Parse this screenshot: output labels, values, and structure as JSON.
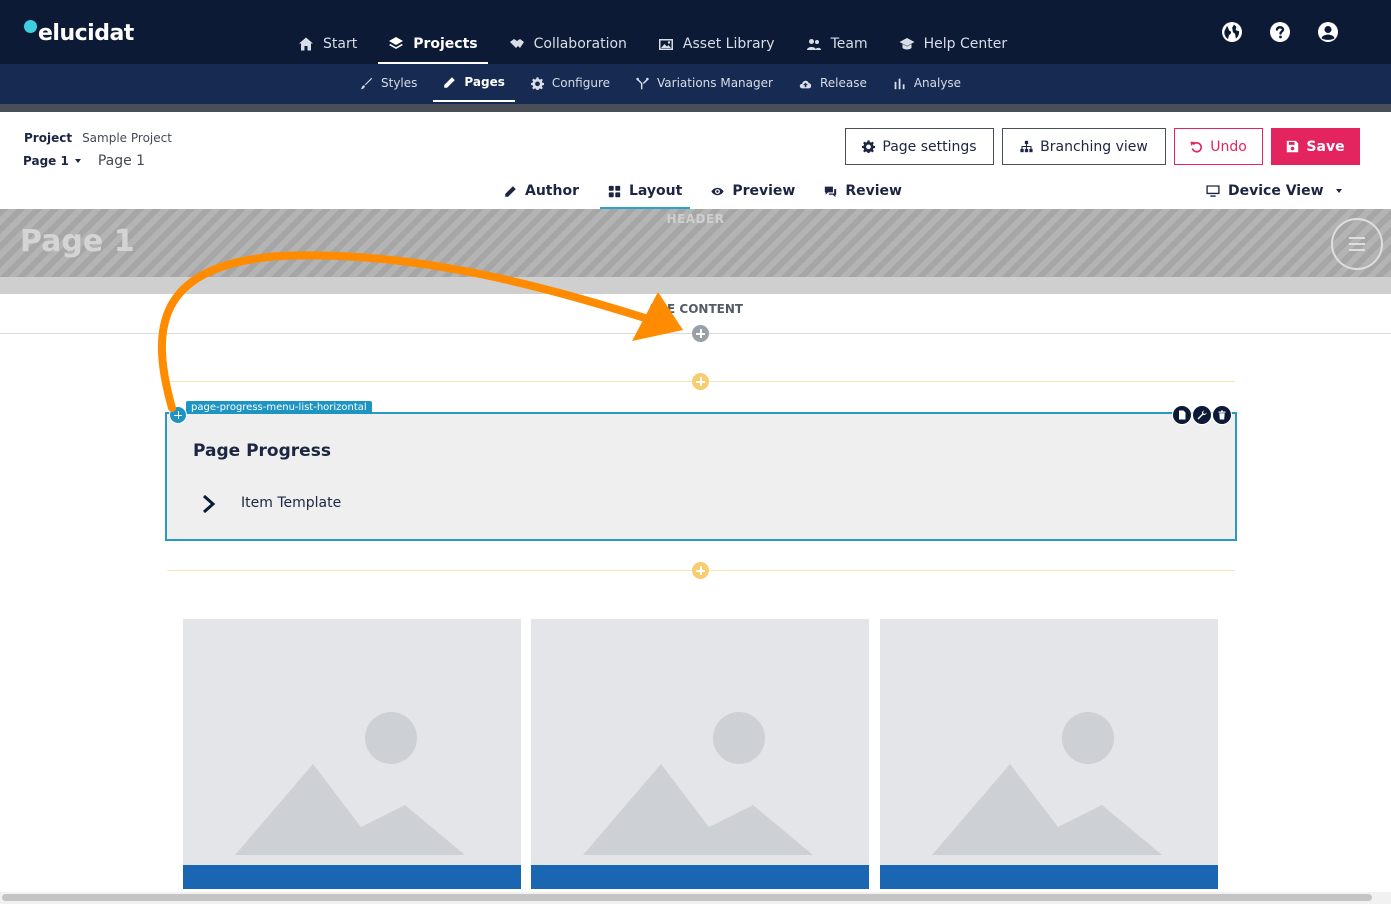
{
  "app": {
    "logo_text": "elucidat"
  },
  "main_nav": [
    {
      "label": "Start",
      "icon": "home-icon"
    },
    {
      "label": "Projects",
      "icon": "layers-icon",
      "active": true
    },
    {
      "label": "Collaboration",
      "icon": "handshake-icon"
    },
    {
      "label": "Asset Library",
      "icon": "images-icon"
    },
    {
      "label": "Team",
      "icon": "users-icon"
    },
    {
      "label": "Help Center",
      "icon": "graduation-cap-icon"
    }
  ],
  "top_icons": [
    "globe-icon",
    "help-icon",
    "user-account-icon"
  ],
  "sub_nav": [
    {
      "label": "Styles",
      "icon": "brush-icon"
    },
    {
      "label": "Pages",
      "icon": "pencil-icon",
      "active": true
    },
    {
      "label": "Configure",
      "icon": "gear-icon"
    },
    {
      "label": "Variations Manager",
      "icon": "branch-icon"
    },
    {
      "label": "Release",
      "icon": "cloud-upload-icon"
    },
    {
      "label": "Analyse",
      "icon": "bar-chart-icon"
    }
  ],
  "breadcrumb": {
    "project_label": "Project",
    "project_value": "Sample Project",
    "page_label": "Page 1",
    "page_value": "Page 1"
  },
  "actions": {
    "page_settings": "Page settings",
    "branching_view": "Branching view",
    "undo": "Undo",
    "save": "Save"
  },
  "mode_tabs": [
    {
      "label": "Author",
      "icon": "pencil-icon"
    },
    {
      "label": "Layout",
      "icon": "grid-icon",
      "active": true
    },
    {
      "label": "Preview",
      "icon": "eye-icon"
    },
    {
      "label": "Review",
      "icon": "comments-icon"
    }
  ],
  "device_view": {
    "label": "Device View",
    "icon": "desktop-icon"
  },
  "canvas": {
    "header_label": "HEADER",
    "page_title": "Page 1",
    "content_label": "AGE CONTENT",
    "component": {
      "tag": "page-progress-menu-list-horizontal",
      "title": "Page Progress",
      "item": "Item Template"
    },
    "image_card_count": 3
  },
  "colors": {
    "topbar": "#0c1a36",
    "subnav": "#162a52",
    "accent": "#e3245f",
    "selection": "#2a9ac4",
    "annotation_arrow": "#ff8c00",
    "card_bar": "#1b66b3"
  }
}
